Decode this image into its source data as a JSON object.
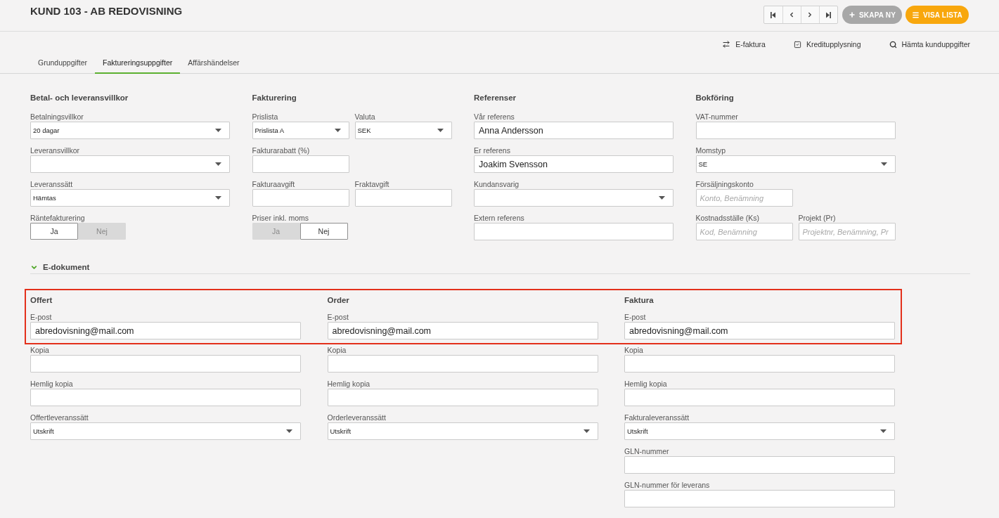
{
  "header": {
    "title": "KUND 103 - AB REDOVISNING",
    "buttons": [
      {
        "label": "SKAPA NY",
        "kind": "create"
      },
      {
        "label": "VISA LISTA",
        "kind": "list"
      }
    ]
  },
  "actions": [
    {
      "label": "E-faktura",
      "kind": "transfer"
    },
    {
      "label": "Kreditupplysning",
      "kind": "check"
    },
    {
      "label": "Hämta kunduppgifter",
      "kind": "search"
    }
  ],
  "tabs": [
    {
      "label": "Grunduppgifter",
      "selected": false
    },
    {
      "label": "Faktureringsuppgifter",
      "selected": true
    },
    {
      "label": "Affärshändelser",
      "selected": false
    }
  ],
  "sections": [
    {
      "title": "Betal- och leveransvillkor",
      "rows": [
        {
          "fields": [
            {
              "label": "Betalningsvillkor",
              "kind": "select",
              "value": "20 dagar"
            }
          ]
        },
        {
          "fields": [
            {
              "label": "Leveransvillkor",
              "kind": "select"
            }
          ]
        },
        {
          "fields": [
            {
              "label": "Leveranssätt",
              "kind": "select",
              "value": "Hämtas"
            }
          ]
        },
        {
          "fields": [
            {
              "label": "Räntefakturering",
              "kind": "toggle",
              "options": [
                {
                  "label": "Ja",
                  "selected": true
                },
                {
                  "label": "Nej",
                  "selected": false
                }
              ]
            }
          ]
        }
      ]
    },
    {
      "title": "Fakturering",
      "rows": [
        {
          "fields": [
            {
              "label": "Prislista",
              "kind": "select",
              "value": "Prislista A"
            },
            {
              "label": "Valuta",
              "kind": "select",
              "value": "SEK"
            }
          ]
        },
        {
          "fields": [
            {
              "label": "Fakturarabatt (%)",
              "kind": "number"
            }
          ]
        },
        {
          "fields": [
            {
              "label": "Fakturaavgift",
              "kind": "number"
            },
            {
              "label": "Fraktavgift",
              "kind": "number"
            }
          ]
        },
        {
          "fields": [
            {
              "label": "Priser inkl. moms",
              "kind": "toggle",
              "options": [
                {
                  "label": "Ja",
                  "selected": false
                },
                {
                  "label": "Nej",
                  "selected": true
                }
              ]
            }
          ]
        }
      ]
    },
    {
      "title": "Referenser",
      "rows": [
        {
          "fields": [
            {
              "label": "Vår referens",
              "kind": "text",
              "value": "Anna Andersson"
            }
          ]
        },
        {
          "fields": [
            {
              "label": "Er referens",
              "kind": "text",
              "value": "Joakim Svensson"
            }
          ]
        },
        {
          "fields": [
            {
              "label": "Kundansvarig",
              "kind": "select"
            }
          ]
        },
        {
          "fields": [
            {
              "label": "Extern referens",
              "kind": "text"
            }
          ]
        }
      ]
    },
    {
      "title": "Bokföring",
      "rows": [
        {
          "fields": [
            {
              "label": "VAT-nummer",
              "kind": "text"
            }
          ]
        },
        {
          "fields": [
            {
              "label": "Momstyp",
              "kind": "select",
              "value": "SE"
            }
          ]
        },
        {
          "fields": [
            {
              "label": "Försäljningskonto",
              "kind": "lookup",
              "placeholder": "Konto, Benämning"
            }
          ]
        },
        {
          "fields": [
            {
              "label": "Kostnadsställe (Ks)",
              "kind": "lookup",
              "placeholder": "Kod, Benämning"
            },
            {
              "label": "Projekt (Pr)",
              "kind": "lookup",
              "placeholder": "Projektnr, Benämning, Pr"
            }
          ]
        }
      ]
    }
  ],
  "edocuments": {
    "title": "E-dokument",
    "expanded": true,
    "email_row_highlighted": true,
    "columns": [
      {
        "title": "Offert",
        "fields": [
          {
            "label": "E-post",
            "kind": "text",
            "value": "abredovisning@mail.com"
          },
          {
            "label": "Kopia",
            "kind": "text"
          },
          {
            "label": "Hemlig kopia",
            "kind": "text"
          },
          {
            "label": "Offertleveranssätt",
            "kind": "select",
            "value": "Utskrift"
          }
        ]
      },
      {
        "title": "Order",
        "fields": [
          {
            "label": "E-post",
            "kind": "text",
            "value": "abredovisning@mail.com"
          },
          {
            "label": "Kopia",
            "kind": "text"
          },
          {
            "label": "Hemlig kopia",
            "kind": "text"
          },
          {
            "label": "Orderleveranssätt",
            "kind": "select",
            "value": "Utskrift"
          }
        ]
      },
      {
        "title": "Faktura",
        "fields": [
          {
            "label": "E-post",
            "kind": "text",
            "value": "abredovisning@mail.com"
          },
          {
            "label": "Kopia",
            "kind": "text"
          },
          {
            "label": "Hemlig kopia",
            "kind": "text"
          },
          {
            "label": "Fakturaleveranssätt",
            "kind": "select",
            "value": "Utskrift"
          },
          {
            "label": "GLN-nummer",
            "kind": "text"
          },
          {
            "label": "GLN-nummer för leverans",
            "kind": "text"
          }
        ]
      }
    ]
  }
}
